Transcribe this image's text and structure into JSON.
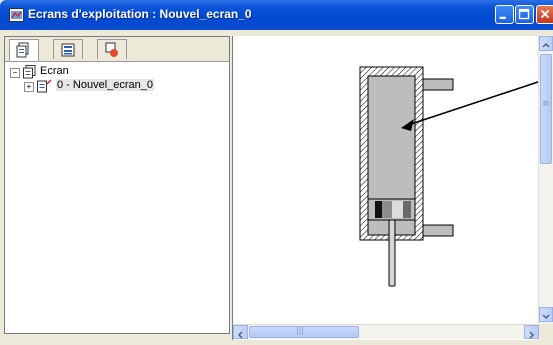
{
  "window": {
    "title": "Ecrans d'exploitation : Nouvel_ecran_0"
  },
  "tabs": [
    {
      "icon": "screens-icon",
      "active": true
    },
    {
      "icon": "list-icon",
      "active": false
    },
    {
      "icon": "objects-icon",
      "active": false
    }
  ],
  "tree": {
    "root": {
      "label": "Ecran",
      "expander": "−"
    },
    "child": {
      "label": "0 - Nouvel_ecran_0",
      "expander": "+"
    }
  },
  "scrollbar": {
    "horizontal_thumb_glyph": "|||",
    "vertical_thumb_glyph": "≡"
  },
  "colors": {
    "titlebar": "#0a54d8",
    "close_button": "#d5502b",
    "cylinder_fill": "#bdbdbd"
  }
}
